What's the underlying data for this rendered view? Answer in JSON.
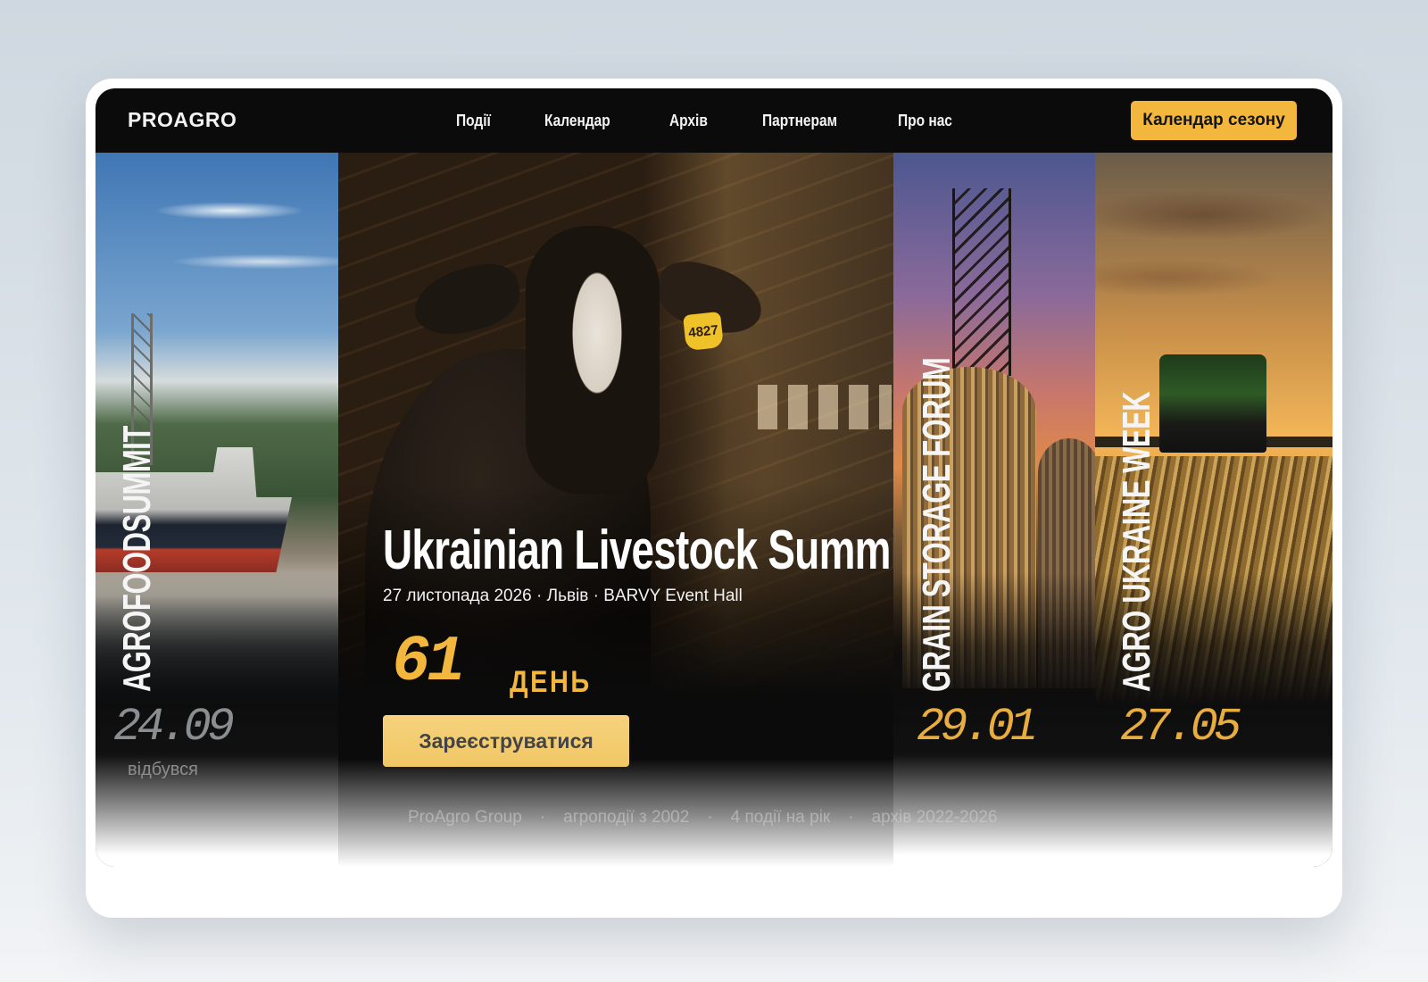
{
  "brand": {
    "logo": "PROAGRO"
  },
  "nav": {
    "items": [
      "Події",
      "Календар",
      "Архів",
      "Партнерам",
      "Про нас"
    ],
    "cta_label": "Календар сезону"
  },
  "panels": [
    {
      "title": "AGROFOODSUMMIT",
      "date": "24.09",
      "status": "відбувся"
    },
    {
      "title": "Ukrainian Livestock Summit",
      "meta": "27 листопада 2026 · Львів · BARVY Event Hall",
      "countdown_value": "61",
      "countdown_unit": "ДЕНЬ",
      "ear_tag": "4827",
      "register_label": "Зареєструватися"
    },
    {
      "title": "GRAIN STORAGE FORUM",
      "date": "29.01"
    },
    {
      "title": "AGRO UKRAINE WEEK",
      "date": "27.05"
    }
  ],
  "footer": {
    "items": [
      "ProAgro Group",
      "агроподії з 2002",
      "4 події на рік",
      "архів 2022-2026"
    ],
    "separator": "·"
  },
  "colors": {
    "accent": "#f2b73c",
    "nav_bg": "#0b0b0b",
    "muted_date": "#8b8e91"
  }
}
